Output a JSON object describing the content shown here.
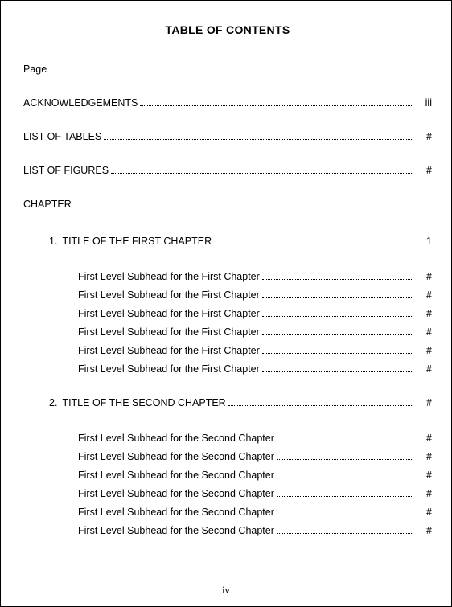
{
  "title": "TABLE OF CONTENTS",
  "page_label": "Page",
  "front_matter": [
    {
      "label": "ACKNOWLEDGEMENTS",
      "page": "iii"
    },
    {
      "label": "LIST OF TABLES",
      "page": "#"
    },
    {
      "label": "LIST OF FIGURES",
      "page": "#"
    }
  ],
  "chapter_heading": "CHAPTER",
  "chapters": [
    {
      "number": "1.",
      "title": "TITLE OF THE FIRST CHAPTER",
      "page": "1",
      "subheads": [
        {
          "label": "First Level Subhead for the First Chapter",
          "page": "#"
        },
        {
          "label": "First Level Subhead for the First Chapter",
          "page": "#"
        },
        {
          "label": "First Level Subhead for the First Chapter",
          "page": "#"
        },
        {
          "label": "First Level Subhead for the First Chapter",
          "page": "#"
        },
        {
          "label": "First Level Subhead for the First Chapter",
          "page": "#"
        },
        {
          "label": "First Level Subhead for the First Chapter",
          "page": "#"
        }
      ]
    },
    {
      "number": "2.",
      "title": "TITLE OF THE SECOND CHAPTER",
      "page": "#",
      "subheads": [
        {
          "label": "First Level Subhead for the Second Chapter",
          "page": "#"
        },
        {
          "label": "First Level Subhead for the Second Chapter",
          "page": "#"
        },
        {
          "label": "First Level Subhead for the Second Chapter",
          "page": "#"
        },
        {
          "label": "First Level Subhead for the Second Chapter",
          "page": "#"
        },
        {
          "label": "First Level Subhead for the Second Chapter",
          "page": "#"
        },
        {
          "label": "First Level Subhead for the Second Chapter",
          "page": "#"
        }
      ]
    }
  ],
  "footer_page": "iv"
}
